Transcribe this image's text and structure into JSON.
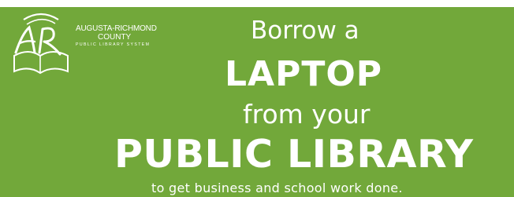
{
  "logo": {
    "line1": "AUGUSTA-RICHMOND",
    "line2": "COUNTY",
    "line3": "PUBLIC LIBRARY SYSTEM"
  },
  "headline": {
    "line1": "Borrow a",
    "line2": "LAPTOP",
    "line3": "from your",
    "line4": "PUBLIC LIBRARY",
    "line5": "to get business and school work done."
  },
  "colors": {
    "background": "#72a83a",
    "text": "#ffffff"
  }
}
